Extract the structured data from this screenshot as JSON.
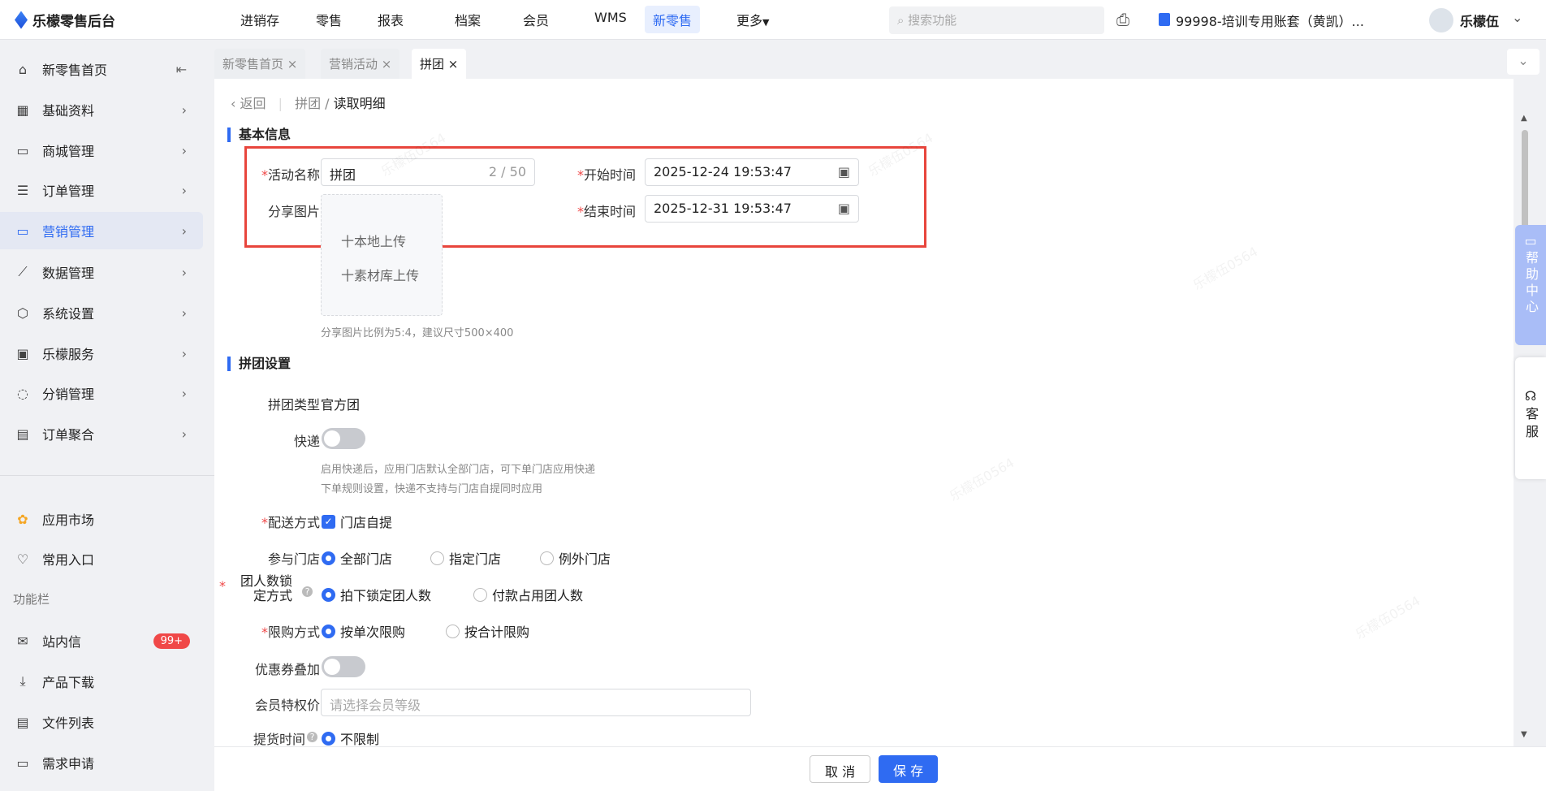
{
  "app": {
    "title": "乐檬零售后台"
  },
  "nav": [
    "进销存",
    "零售",
    "报表",
    "档案",
    "会员",
    "WMS",
    "新零售",
    "更多"
  ],
  "search_placeholder": "搜索功能",
  "account": "99998-培训专用账套（黄凯）...",
  "user": "乐檬伍",
  "sidebar": {
    "items": [
      "新零售首页",
      "基础资料",
      "商城管理",
      "订单管理",
      "营销管理",
      "数据管理",
      "系统设置",
      "乐檬服务",
      "分销管理",
      "订单聚合"
    ],
    "extra": [
      "应用市场",
      "常用入口"
    ],
    "section": "功能栏",
    "tools": [
      "站内信",
      "产品下载",
      "文件列表",
      "需求申请"
    ],
    "badge": "99+"
  },
  "tabs": [
    "新零售首页",
    "营销活动",
    "拼团"
  ],
  "breadcrumb": {
    "back": "返回",
    "parent": "拼团",
    "current": "读取明细"
  },
  "basic": {
    "title": "基本信息",
    "name_label": "活动名称",
    "name_value": "拼团",
    "name_count": "2 / 50",
    "start_label": "开始时间",
    "start_value": "2025-12-24 19:53:47",
    "end_label": "结束时间",
    "end_value": "2025-12-31 19:53:47",
    "image_label": "分享图片",
    "upload_local": "十本地上传",
    "upload_lib": "十素材库上传",
    "image_hint": "分享图片比例为5:4，建议尺寸500×400"
  },
  "group": {
    "title": "拼团设置",
    "type_label": "拼团类型",
    "type_value": "官方团",
    "express_label": "快递",
    "express_hint1": "启用快递后，应用门店默认全部门店，可下单门店应用快递",
    "express_hint2": "下单规则设置，快递不支持与门店自提同时应用",
    "delivery_label": "配送方式",
    "delivery_value": "门店自提",
    "store_label": "参与门店",
    "store_options": [
      "全部门店",
      "指定门店",
      "例外门店"
    ],
    "lock_label1": "团人数锁",
    "lock_label2": "定方式",
    "lock_options": [
      "拍下锁定团人数",
      "付款占用团人数"
    ],
    "limit_label": "限购方式",
    "limit_options": [
      "按单次限购",
      "按合计限购"
    ],
    "coupon_label": "优惠券叠加",
    "member_label": "会员特权价",
    "member_placeholder": "请选择会员等级",
    "pickup_label": "提货时间",
    "pickup_value": "不限制"
  },
  "footer": {
    "cancel": "取 消",
    "save": "保 存"
  },
  "help": {
    "help_center": "帮助中心",
    "service": "客服"
  },
  "watermark": "乐檬伍0564"
}
